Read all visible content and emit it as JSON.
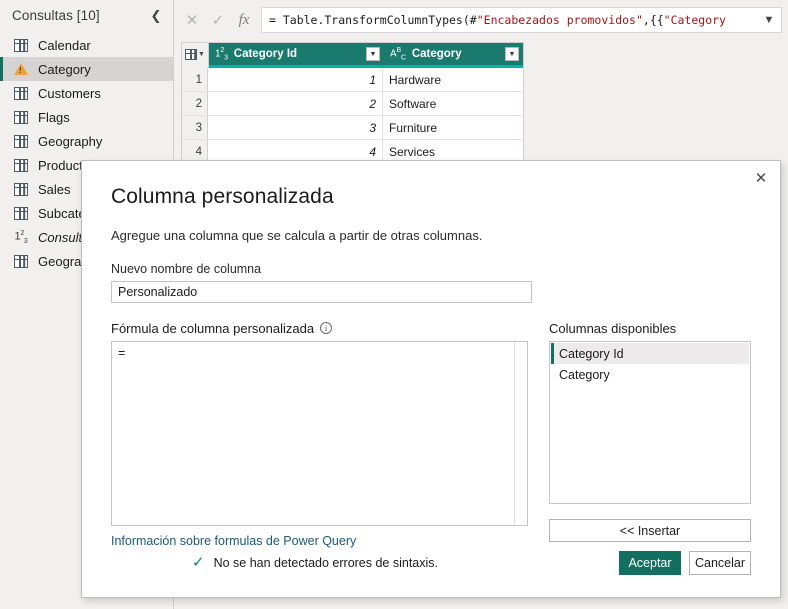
{
  "sidebar": {
    "title": "Consultas [10]",
    "collapse_icon": "chevron-left-icon",
    "items": [
      {
        "label": "Calendar",
        "icon": "table-icon",
        "selected": false,
        "italic": false
      },
      {
        "label": "Category",
        "icon": "warning-icon",
        "selected": true,
        "italic": false
      },
      {
        "label": "Customers",
        "icon": "table-icon",
        "selected": false,
        "italic": false
      },
      {
        "label": "Flags",
        "icon": "table-icon",
        "selected": false,
        "italic": false
      },
      {
        "label": "Geography",
        "icon": "table-icon",
        "selected": false,
        "italic": false
      },
      {
        "label": "Products",
        "icon": "table-icon",
        "selected": false,
        "italic": false
      },
      {
        "label": "Sales",
        "icon": "table-icon",
        "selected": false,
        "italic": false
      },
      {
        "label": "Subcateg",
        "icon": "table-icon",
        "selected": false,
        "italic": false
      },
      {
        "label": "Consulta",
        "icon": "number-icon",
        "selected": false,
        "italic": true
      },
      {
        "label": "Geografi",
        "icon": "table-icon",
        "selected": false,
        "italic": false
      }
    ]
  },
  "formula_bar": {
    "cancel_icon": "close-icon",
    "accept_icon": "check-icon",
    "fx_icon": "fx-icon",
    "expand_icon": "chevron-down-icon",
    "prefix": "= Table.TransformColumnTypes(#",
    "arg_quoted": "\"Encabezados promovidos\"",
    "mid": ",{{",
    "string_literal": "\"Category"
  },
  "grid": {
    "corner_icon": "select-all-table-icon",
    "columns": [
      {
        "name": "Category Id",
        "type_badge": "123",
        "selected": true,
        "filter_icon": "filter-dropdown-icon"
      },
      {
        "name": "Category",
        "type_badge": "ABC",
        "selected": false,
        "filter_icon": "filter-dropdown-icon"
      }
    ],
    "rows": [
      {
        "num": "1",
        "category_id": "1",
        "category": "Hardware"
      },
      {
        "num": "2",
        "category_id": "2",
        "category": "Software"
      },
      {
        "num": "3",
        "category_id": "3",
        "category": "Furniture"
      },
      {
        "num": "4",
        "category_id": "4",
        "category": "Services"
      }
    ]
  },
  "dialog": {
    "close_icon": "close-icon",
    "title": "Columna personalizada",
    "subtitle": "Agregue una columna que se calcula a partir de otras columnas.",
    "name_label": "Nuevo nombre de columna",
    "name_value": "Personalizado",
    "name_placeholder": "Personalizado",
    "formula_label": "Fórmula de columna personalizada",
    "formula_info_icon": "info-icon",
    "formula_value": "=",
    "help_link": "Información sobre formulas de Power Query",
    "available_label": "Columnas disponibles",
    "available_columns": [
      {
        "label": "Category Id",
        "selected": true
      },
      {
        "label": "Category",
        "selected": false
      }
    ],
    "insert_label": "<< Insertar",
    "status_icon": "check-icon",
    "status_text": "No se han detectado errores de sintaxis.",
    "ok_label": "Aceptar",
    "cancel_label": "Cancelar"
  },
  "colors": {
    "accent_green": "#11705f",
    "header_green": "#1b7a6e",
    "underline_teal": "#00b4a6",
    "warning_amber": "#e8a33d",
    "link_blue": "#1b5a7a"
  }
}
